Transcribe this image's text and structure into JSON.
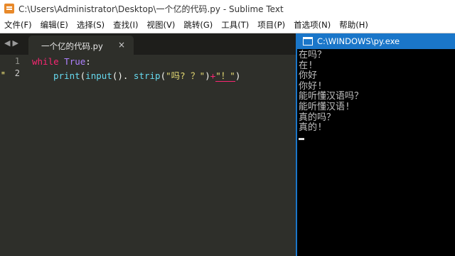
{
  "window": {
    "title": "C:\\Users\\Administrator\\Desktop\\一个亿的代码.py - Sublime Text"
  },
  "menu": {
    "items": [
      "文件(F)",
      "编辑(E)",
      "选择(S)",
      "查找(I)",
      "视图(V)",
      "跳转(G)",
      "工具(T)",
      "项目(P)",
      "首选项(N)",
      "帮助(H)"
    ]
  },
  "editor": {
    "tab_label": "一个亿的代码.py",
    "tab_close": "×",
    "line_numbers": [
      "1",
      "2"
    ],
    "gutter_marker": "≡",
    "code": {
      "line1": {
        "kw": "while",
        "const": "True",
        "colon": ":"
      },
      "line2": {
        "fn1": "print",
        "p1": "(",
        "fn2": "input",
        "p2": "(). ",
        "fn3": "strip",
        "p3": "(",
        "s1": "\"吗? ？\"",
        "p4": ")",
        "op": "+",
        "s2": "\"！\"",
        "p5": ")"
      }
    }
  },
  "console": {
    "title": "C:\\WINDOWS\\py.exe",
    "lines": [
      "在吗？",
      "在!",
      "你好",
      "你好!",
      "能听懂汉语吗？",
      "能听懂汉语!",
      "真的吗？",
      "真的!"
    ]
  }
}
